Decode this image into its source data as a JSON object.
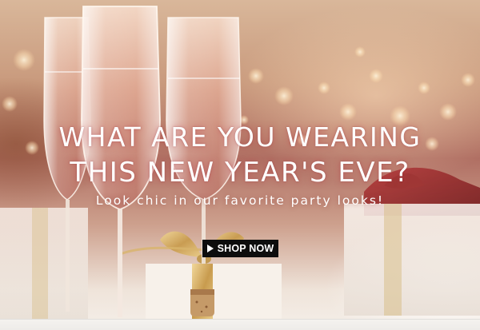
{
  "banner": {
    "headline_line1": "WHAT ARE YOU WEARING",
    "headline_line2": "THIS NEW YEAR'S EVE?",
    "subheadline": "Look chic in our favorite party looks!",
    "cta_label": "SHOP NOW",
    "cta_icon": "play-icon"
  },
  "colors": {
    "headline_text": "#ffffff",
    "button_background": "#0d0d0d",
    "button_text": "#ffffff",
    "champagne": "#e9b9a4",
    "ribbon_red": "#8e2326",
    "ribbon_gold": "#d7b36a"
  }
}
